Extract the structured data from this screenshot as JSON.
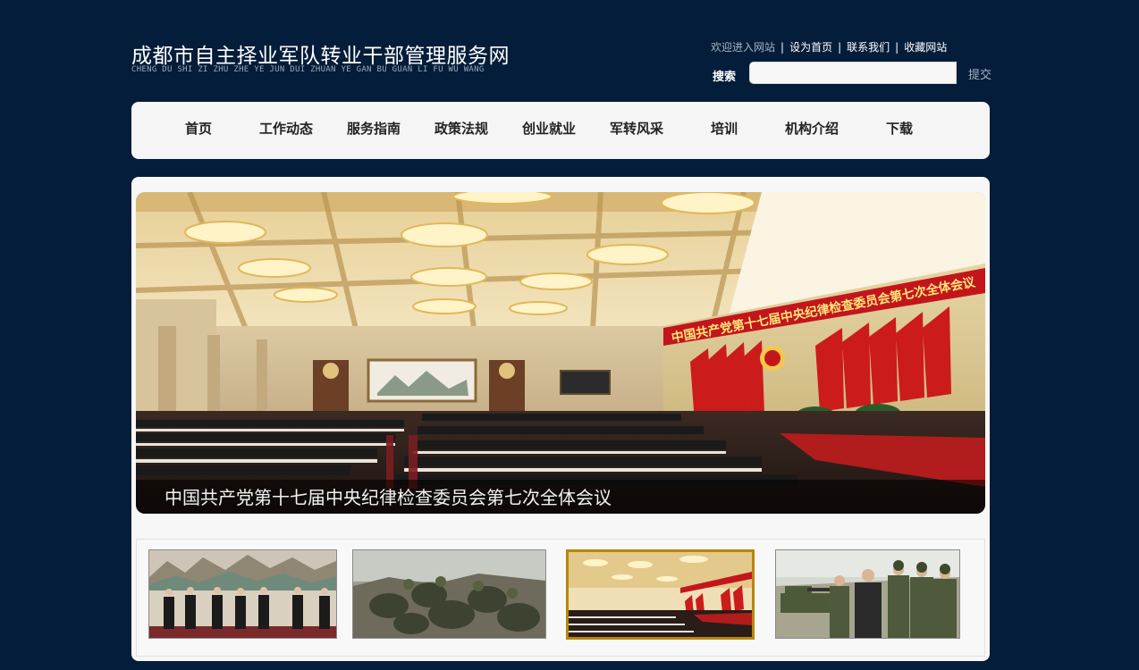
{
  "header": {
    "title": "成都市自主择业军队转业干部管理服务网",
    "subtitle": "CHENG DU SHI ZI ZHU ZHE YE JUN DUI ZHUAN YE GAN BU GUAN LI FU WU WANG"
  },
  "top_links": {
    "welcome": "欢迎进入网站",
    "set_home": "设为首页",
    "contact": "联系我们",
    "bookmark": "收藏网站",
    "separator": "|"
  },
  "search": {
    "label": "搜索",
    "value": "",
    "submit": "提交"
  },
  "nav": {
    "items": [
      "首页",
      "工作动态",
      "服务指南",
      "政策法规",
      "创业就业",
      "军转风采",
      "培训",
      "机构介绍",
      "下载"
    ]
  },
  "hero": {
    "caption": "中国共产党第十七届中央纪律检查委员会第七次全体会议",
    "banner_text": "中国共产党第十七届中央纪律检查委员会第七次全体会议"
  },
  "thumbnails": {
    "active_index": 2
  },
  "colors": {
    "page_background": "#041d3a",
    "panel_background": "#f7f7f7",
    "active_thumb_border": "#b8860b"
  }
}
